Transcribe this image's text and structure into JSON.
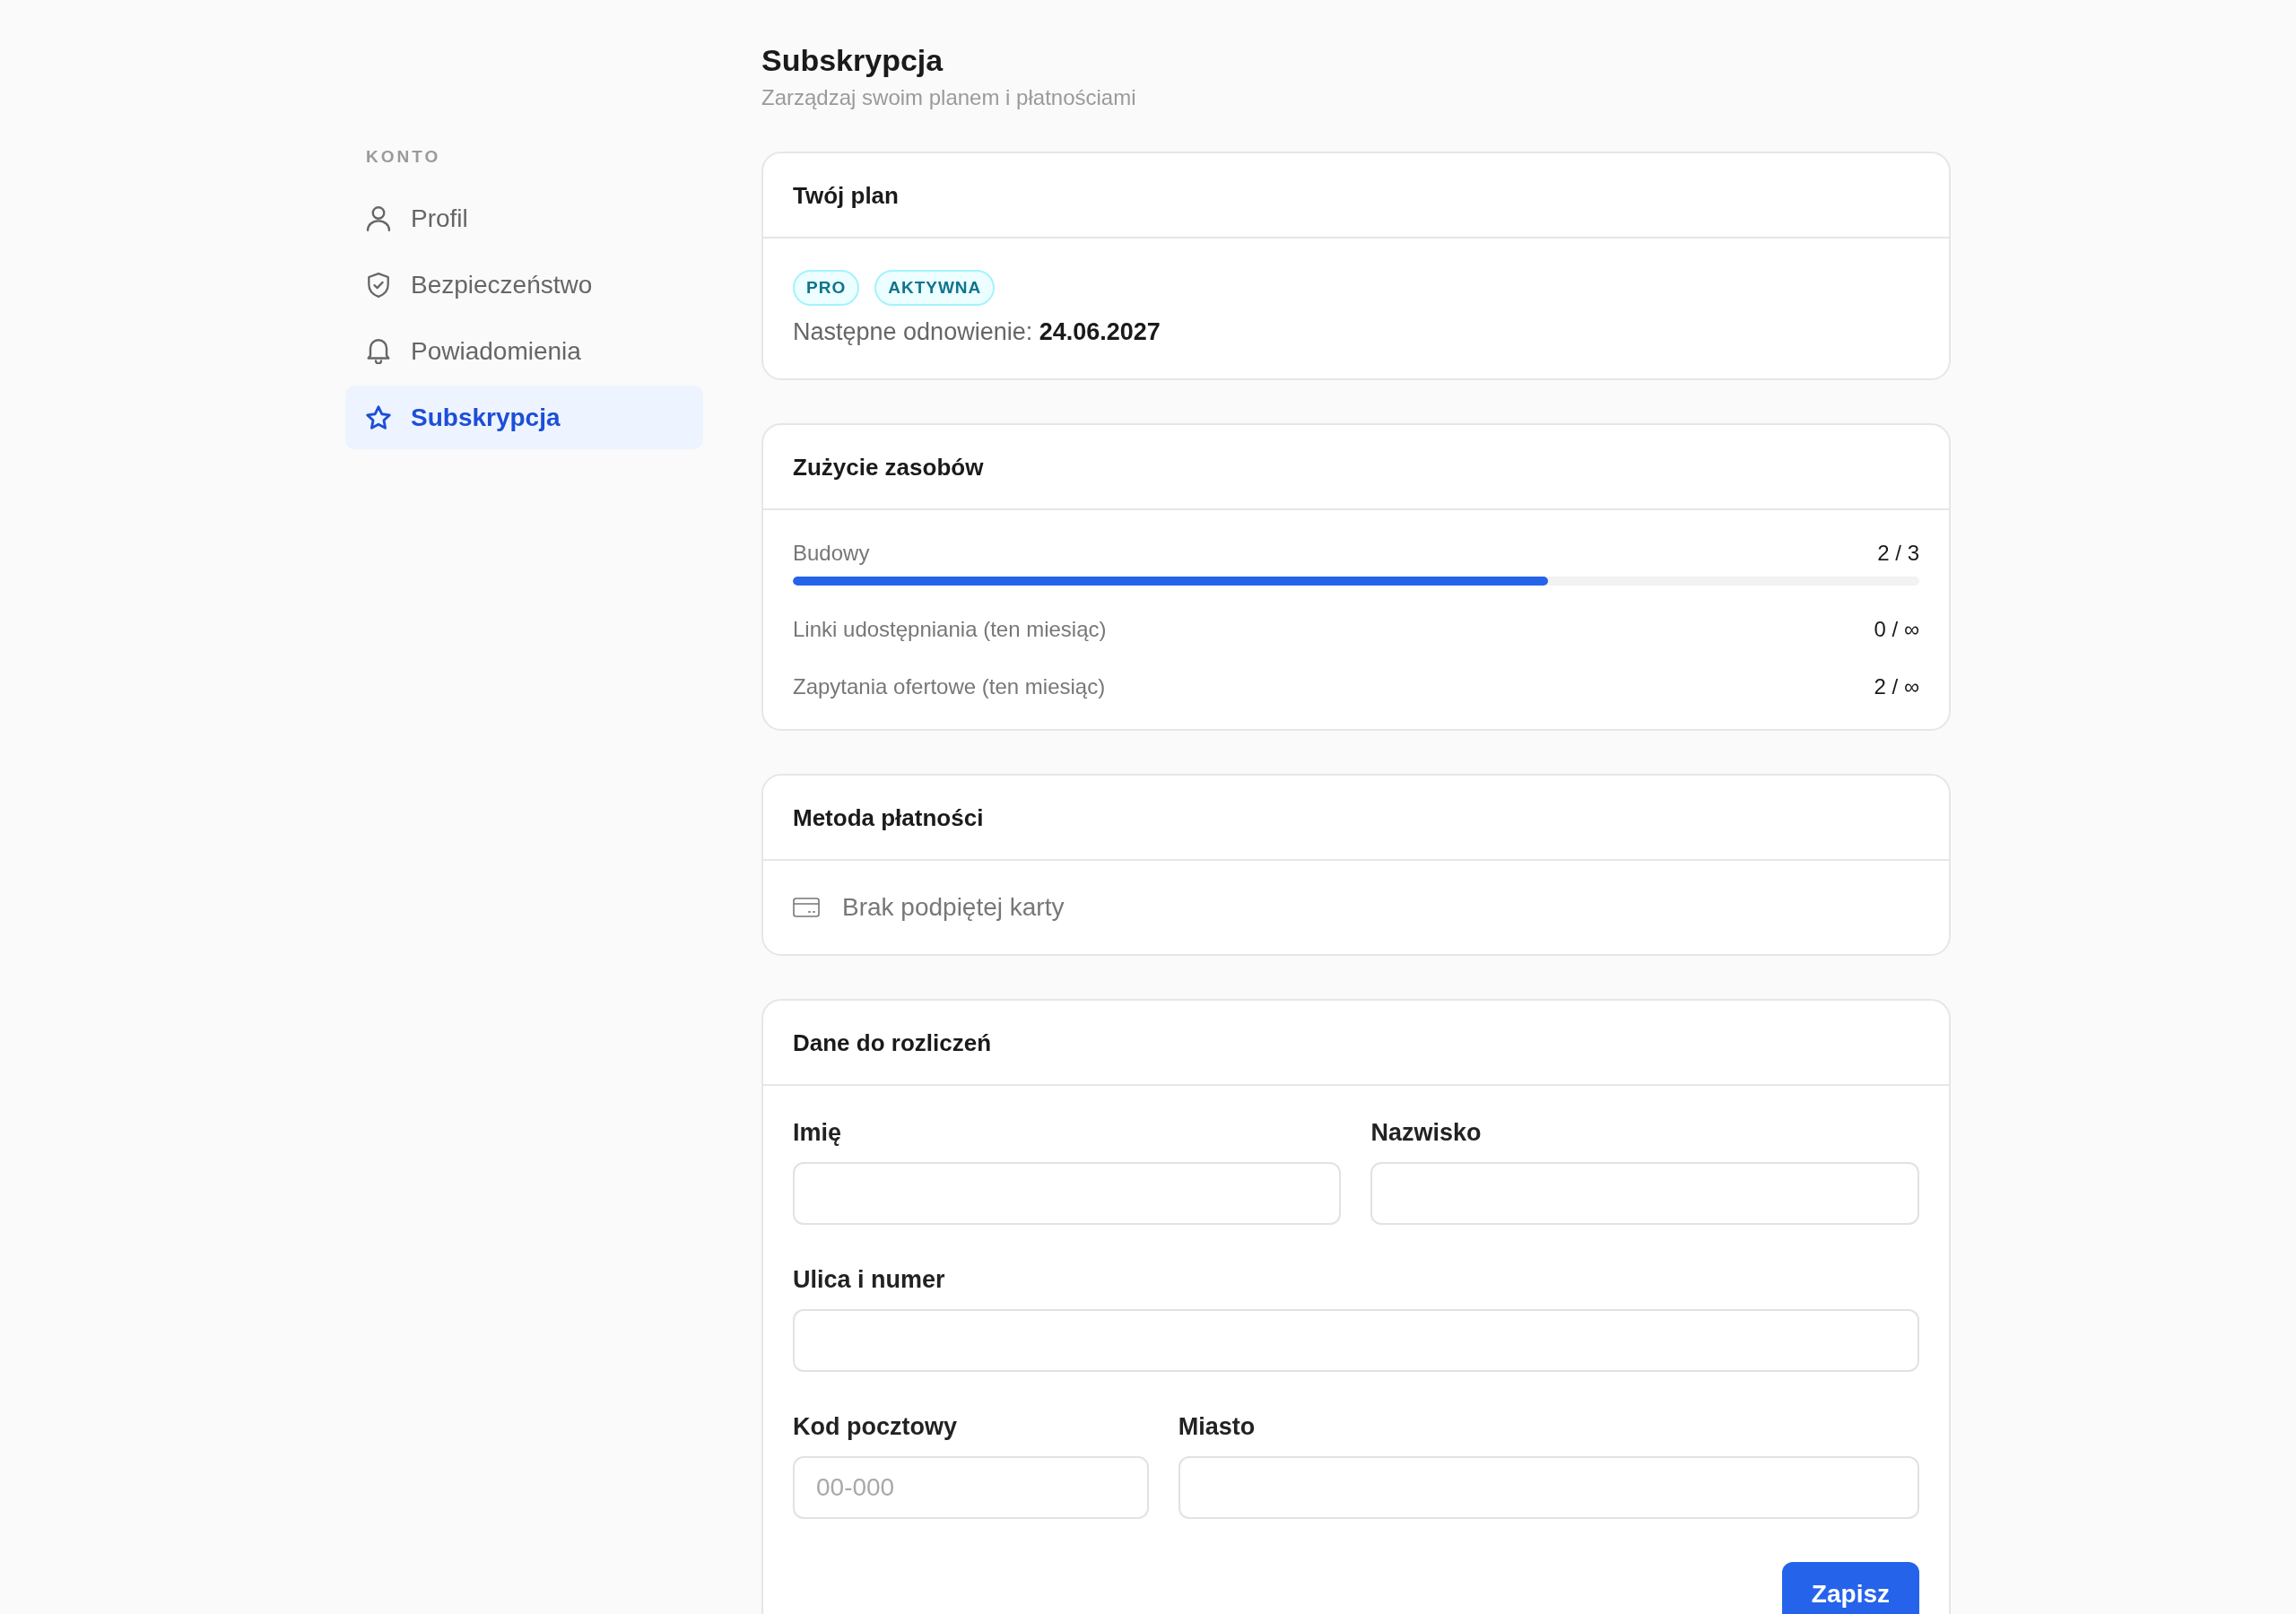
{
  "sidebar": {
    "section_label": "KONTO",
    "items": [
      {
        "label": "Profil",
        "selected": false
      },
      {
        "label": "Bezpieczeństwo",
        "selected": false
      },
      {
        "label": "Powiadomienia",
        "selected": false
      },
      {
        "label": "Subskrypcja",
        "selected": true
      }
    ]
  },
  "header": {
    "title": "Subskrypcja",
    "subtitle": "Zarządzaj swoim planem i płatnościami"
  },
  "plan_card": {
    "title": "Twój plan",
    "badges": [
      "PRO",
      "AKTYWNA"
    ],
    "renewal": "Następne odnowienie: **24.06.2027**"
  },
  "usage_card": {
    "title": "Zużycie zasobów",
    "items": [
      {
        "kind": "meter",
        "label": "Budowy",
        "value": "2 / 3",
        "level": 0.67
      },
      {
        "kind": "count",
        "label": "Linki udostępniania (ten miesiąc)",
        "value": "0 / ∞"
      },
      {
        "kind": "count",
        "label": "Zapytania ofertowe (ten miesiąc)",
        "value": "2 / ∞"
      }
    ]
  },
  "payment_card": {
    "title": "Metoda płatności",
    "empty_text": "Brak podpiętej karty"
  },
  "billing_card": {
    "title": "Dane do rozliczeń",
    "fields": [
      {
        "label": "Imię"
      },
      {
        "label": "Nazwisko"
      },
      {
        "label": "Ulica i numer"
      },
      {
        "label": "Kod pocztowy",
        "placeholder": "00-000"
      },
      {
        "label": "Miasto"
      }
    ],
    "save_button": "Zapisz"
  }
}
